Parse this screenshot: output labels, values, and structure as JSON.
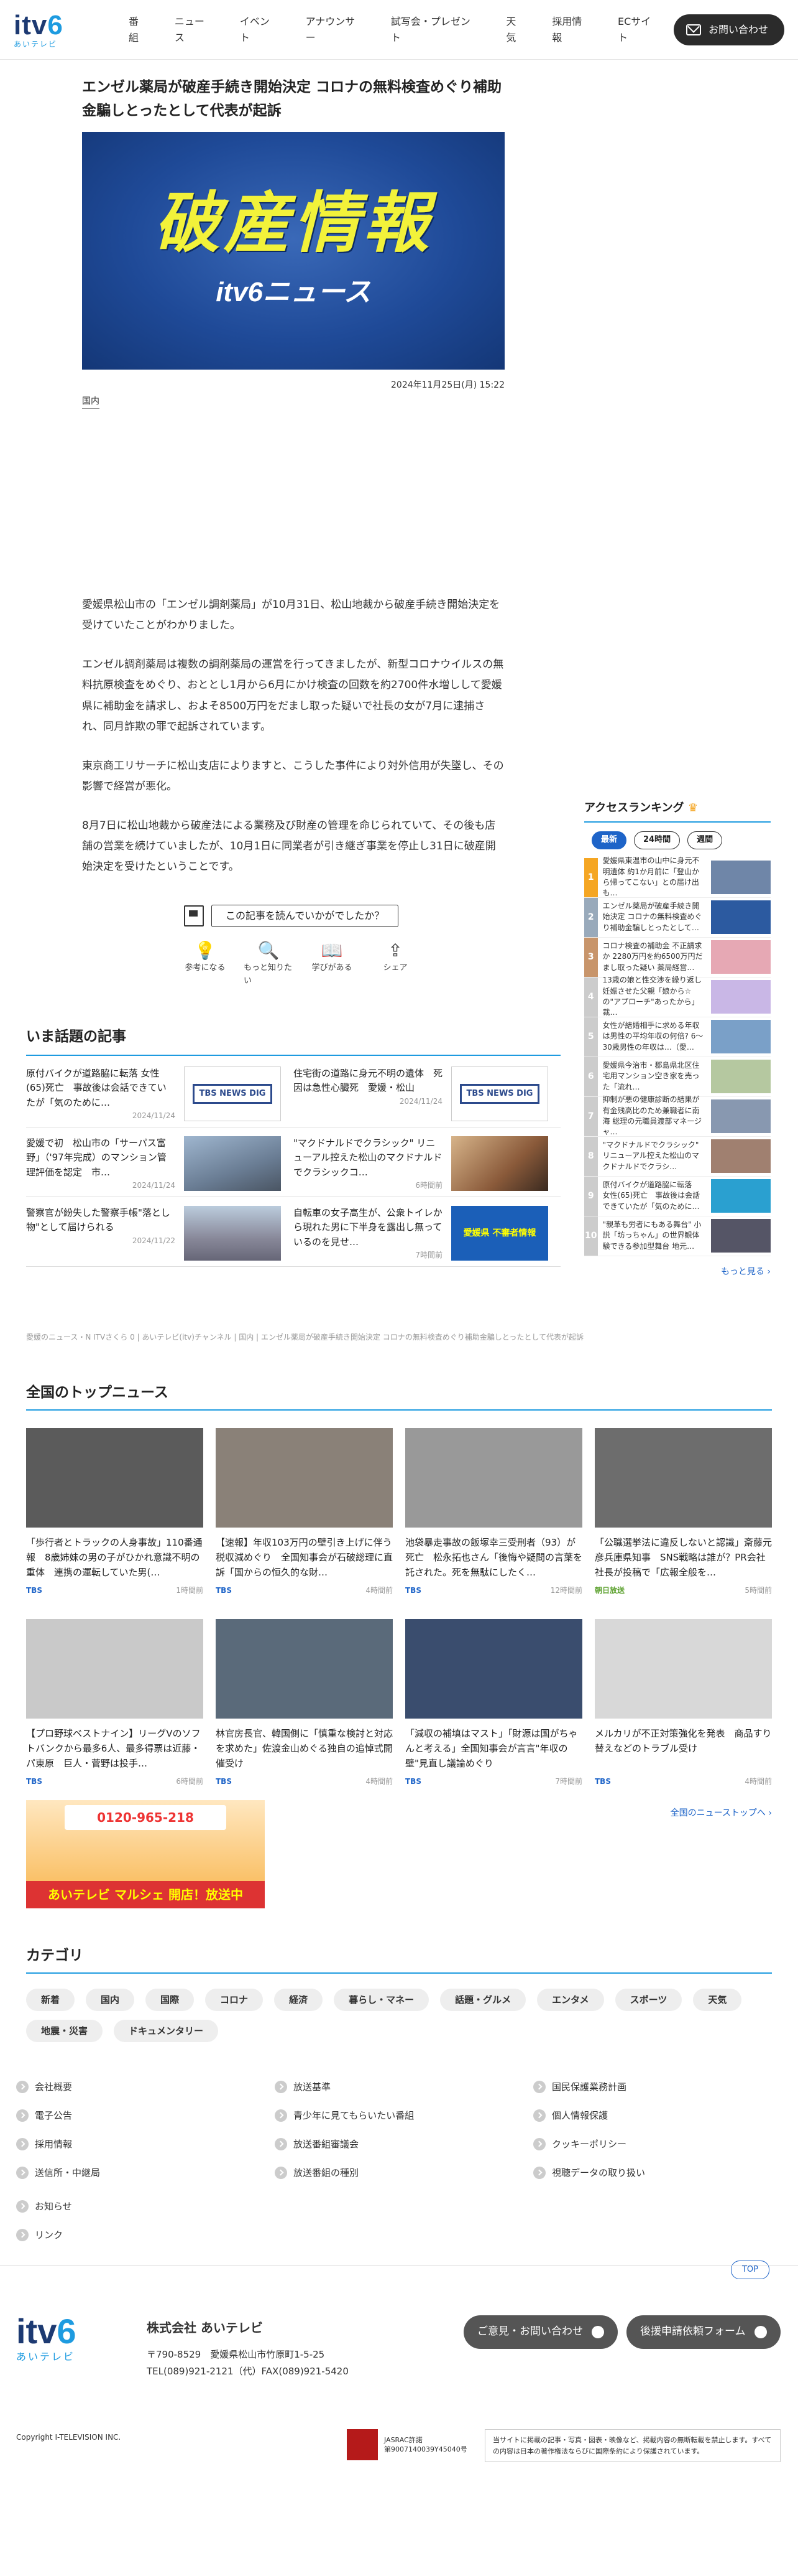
{
  "header": {
    "logo_text": "itv",
    "logo_num": "6",
    "logo_sub": "あいテレビ",
    "nav": [
      "番組",
      "ニュース",
      "イベント",
      "アナウンサー",
      "試写会・プレゼント",
      "天気",
      "採用情報",
      "ECサイト"
    ],
    "contact": "お問い合わせ"
  },
  "article": {
    "title": "エンゼル薬局が破産手続き開始決定 コロナの無料検査めぐり補助金騙しとったとして代表が起訴",
    "hero_big": "破産情報",
    "hero_sub": "itv6ニュース",
    "date": "2024年11月25日(月) 15:22",
    "category": "国内",
    "paragraphs": [
      "愛媛県松山市の「エンゼル調剤薬局」が10月31日、松山地裁から破産手続き開始決定を受けていたことがわかりました。",
      "エンゼル調剤薬局は複数の調剤薬局の運営を行ってきましたが、新型コロナウイルスの無料抗原検査をめぐり、おととし1月から6月にかけ検査の回数を約2700件水増しして愛媛県に補助金を請求し、およそ8500万円をだまし取った疑いで社長の女が7月に逮捕され、同月詐欺の罪で起訴されています。",
      "東京商工リサーチに松山支店によりますと、こうした事件により対外信用が失墜し、その影響で経営が悪化。",
      "8月7日に松山地裁から破産法による業務及び財産の管理を命じられていて、その後も店舗の営業を続けていましたが、10月1日に同業者が引き継ぎ事業を停止し31日に破産開始決定を受けたということです。"
    ],
    "question": "この記事を読んでいかがでしたか？",
    "reactions": [
      {
        "icon": "bulb-icon",
        "glyph": "💡",
        "label": "参考になる"
      },
      {
        "icon": "search-icon",
        "glyph": "🔍",
        "label": "もっと知りたい"
      },
      {
        "icon": "book-icon",
        "glyph": "📖",
        "label": "学びがある"
      },
      {
        "icon": "share-icon",
        "glyph": "⇪",
        "label": "シェア"
      }
    ]
  },
  "trending": {
    "heading": "いま話題の記事",
    "items": [
      {
        "title": "原付バイクが道路脇に転落 女性(65)死亡　事故後は会話できていたが「気のために…",
        "date": "2024/11/24",
        "thumb": "tbs",
        "thumb_label": "TBS NEWS DIG"
      },
      {
        "title": "住宅街の道路に身元不明の遺体　死因は急性心臓死　愛媛・松山",
        "date": "2024/11/24",
        "thumb": "tbs",
        "thumb_label": "TBS NEWS DIG"
      },
      {
        "title": "愛媛で初　松山市の「サーパス富野」（'97年完成）のマンション管理評価を認定　市…",
        "date": "2024/11/24",
        "thumb": "building",
        "thumb_label": ""
      },
      {
        "title": "\"マクドナルドでクラシック\" リニューアル控えた松山のマクドナルドでクラシックコ…",
        "date": "6時間前",
        "thumb": "violin",
        "thumb_label": ""
      },
      {
        "title": "警察官が紛失した警察手帳\"落とし物\"として届けられる",
        "date": "2024/11/22",
        "thumb": "city",
        "thumb_label": ""
      },
      {
        "title": "自転車の女子高生が、公衆トイレから現れた男に下半身を露出し無っているのを見せ…",
        "date": "7時間前",
        "thumb": "blue",
        "thumb_label": "愛媛県 不審者情報"
      }
    ]
  },
  "breadcrumb": "愛媛のニュース・N ITVさくら 0 | あいテレビ(itv)チャンネル | 国内 | エンゼル薬局が破産手続き開始決定 コロナの無料検査めぐり補助金騙しとったとして代表が起訴",
  "ranking": {
    "heading": "アクセスランキング",
    "tabs": [
      "最新",
      "24時間",
      "週間"
    ],
    "more": "もっと見る",
    "items": [
      {
        "n": "1",
        "text": "愛媛県東温市の山中に身元不明遺体 約1か月前に「登山から帰ってこない」との届け出も…",
        "c": "#f5a623"
      },
      {
        "n": "2",
        "text": "エンゼル薬局が破産手続き開始決定 コロナの無料検査めぐり補助金騙しとったとして…",
        "c": "#9ab"
      },
      {
        "n": "3",
        "text": "コロナ検査の補助金 不正請求か 2280万円を約6500万円だまし取った疑い 薬局経営…",
        "c": "#c8956b"
      },
      {
        "n": "4",
        "text": "13歳の娘と性交渉を繰り返し妊娠させた父親「娘から☆の\"アプローチ\"あったから」裁…",
        "c": "#ccc"
      },
      {
        "n": "5",
        "text": "女性が結婚相手に求める年収は男性の平均年収の何倍? 6～30歳男性の年収は…（愛…",
        "c": "#ccc"
      },
      {
        "n": "6",
        "text": "愛媛県今治市・郡島県北区住宅用マンション空き家を売った「流れ…",
        "c": "#ccc"
      },
      {
        "n": "7",
        "text": "抑制が悪の健康診断の結果が有金残高比のため兼職者に南海 総理の元職員渡部マネージャ…",
        "c": "#ccc"
      },
      {
        "n": "8",
        "text": "\"マクドナルドでクラシック\" リニューアル控えた松山のマクドナルドでクラシ…",
        "c": "#ccc"
      },
      {
        "n": "9",
        "text": "原付バイクが道路脇に転落　女性(65)死亡　事故後は会話できていたが「気のために…",
        "c": "#ccc"
      },
      {
        "n": "10",
        "text": "\"親革も労者にもある舞台\" 小説「坊っちゃん」の世界観体験できる参加型舞台 地元…",
        "c": "#ccc"
      }
    ]
  },
  "topnews": {
    "heading": "全国のトップニュース",
    "more": "全国のニューストップへ",
    "items": [
      {
        "title": "「歩行者とトラックの人身事故」110番通報　8歳姉妹の男の子がひかれ意識不明の重体　連携の運転していた男(…",
        "src": "TBS",
        "time": "1時間前",
        "bg": "#5b5b5b"
      },
      {
        "title": "【速報】年収103万円の壁引き上げに伴う税収減めぐり　全国知事会が石破総理に直訴「国からの恒久的な財…",
        "src": "TBS",
        "time": "4時間前",
        "bg": "#8a8178"
      },
      {
        "title": "池袋暴走事故の飯塚幸三受刑者（93）が死亡　松永拓也さん「後悔や疑問の言葉を託された。死を無駄にしたく…",
        "src": "TBS",
        "time": "12時間前",
        "bg": "#999"
      },
      {
        "title": "「公職選挙法に違反しないと認識」斎藤元彦兵庫県知事　SNS戦略は誰が？PR会社社長が投稿で「広報全般を…",
        "src": "朝日放送",
        "time": "5時間前",
        "bg": "#6d6d6d"
      },
      {
        "title": "【プロ野球ベストナイン】リーグVのソフトバンクから最多6人、最多得票は近藤・パ東原　巨人・菅野は投手…",
        "src": "TBS",
        "time": "6時間前",
        "bg": "#c9c9c9"
      },
      {
        "title": "林官房長官、韓国側に「慎重な検討と対応を求めた」佐渡金山めぐる独自の追悼式開催受け",
        "src": "TBS",
        "time": "4時間前",
        "bg": "#5a6a7a"
      },
      {
        "title": "「減収の補填はマスト」「財源は国がちゃんと考える」全国知事会が言言\"年収の壁\"見直し議論めぐり",
        "src": "TBS",
        "time": "7時間前",
        "bg": "#3a4d6e"
      },
      {
        "title": "メルカリが不正対策強化を発表　商品すり替えなどのトラブル受け",
        "src": "TBS",
        "time": "4時間前",
        "bg": "#d8d8d8"
      }
    ]
  },
  "banner": {
    "phone": "0120-965-218",
    "label": "あいテレビ マルシェ 開店！放送中"
  },
  "categories": {
    "heading": "カテゴリ",
    "items": [
      "新着",
      "国内",
      "国際",
      "コロナ",
      "経済",
      "暮らし・マネー",
      "話題・グルメ",
      "エンタメ",
      "スポーツ",
      "天気",
      "地震・災害",
      "ドキュメンタリー"
    ]
  },
  "footer": {
    "links": [
      "会社概要",
      "放送基準",
      "国民保護業務計画",
      "電子公告",
      "青少年に見てもらいたい番組",
      "個人情報保護",
      "採用情報",
      "放送番組審議会",
      "クッキーポリシー",
      "送信所・中継局",
      "放送番組の種別",
      "視聴データの取り扱い"
    ],
    "extra": [
      "お知らせ",
      "リンク"
    ],
    "company": "株式会社 あいテレビ",
    "zip": "〒790-8529　愛媛県松山市竹原町1-5-25",
    "tel": "TEL(089)921-2121（代）FAX(089)921-5420",
    "btn1": "ご意見・お問い合わせ",
    "btn2": "後援申請依頼フォーム",
    "top": "TOP",
    "copyright": "Copyright I-TELEVISION INC.",
    "jasrac": "JASRAC許諾\n第9007140039Y45040号",
    "notice": "当サイトに掲載の記事・写真・図表・映像など、掲載内容の無断転載を禁止します。すべての内容は日本の著作権法ならびに国際条約により保護されています。"
  }
}
